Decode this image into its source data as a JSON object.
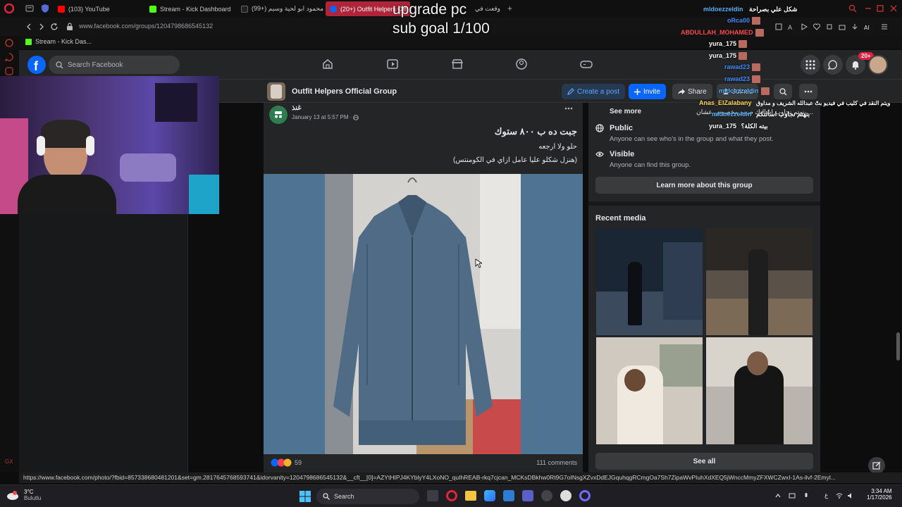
{
  "browser": {
    "tabs": [
      {
        "label": "(103) YouTube",
        "icon": "youtube-icon"
      },
      {
        "label": "Stream - Kick Dashboard",
        "icon": "kick-icon"
      },
      {
        "label": "(99+) محمود ابو لحية وسيم",
        "icon": "tiktok-icon"
      },
      {
        "label": "(20+) Outfit Helpers Off",
        "icon": "facebook-icon"
      },
      {
        "label": "وقعت في",
        "icon": "page-icon"
      }
    ],
    "new_tab": "+",
    "url": "www.facebook.com/groups/1204798686545132",
    "bookmark": "Stream - Kick Das..."
  },
  "stream_overlay": {
    "line1": "upgrade pc",
    "line2": "sub goal 1/100"
  },
  "chat": [
    {
      "user": "mldoezzeldin",
      "msg": "شكل علي بصراحة",
      "color": "#4fb3ff"
    },
    {
      "user": "oRca00",
      "msg": "",
      "color": "#3b8cff"
    },
    {
      "user": "ABDULLAH_MOHAMED",
      "msg": "",
      "color": "#ff4d4d"
    },
    {
      "user": "yura_175",
      "msg": "",
      "color": "#ffffff"
    },
    {
      "user": "yura_175",
      "msg": "",
      "color": "#ffffff"
    },
    {
      "user": "rawad23",
      "msg": "",
      "color": "#3b8cff"
    },
    {
      "user": "rawad23",
      "msg": "",
      "color": "#3b8cff"
    },
    {
      "user": "mldoezzeldin",
      "msg": "",
      "color": "#4fb3ff"
    },
    {
      "user": "Anas_ElZalabany",
      "msg": "ويتم النقد في كليب في فيديو بتّ عبدالله الشريف و مداوق",
      "color": "#ffd84a"
    },
    {
      "user": "mldoezzeldin",
      "msg": "بتهتم نجاوب اسألتكم",
      "color": "#4fb3ff"
    },
    {
      "user": "yura_175",
      "msg": "بيته الكلة؟",
      "color": "#ffffff"
    }
  ],
  "facebook": {
    "search_placeholder": "Search Facebook",
    "notification_count": "20+",
    "group_name": "Outfit Helpers Official Group",
    "create_post": "Create a post",
    "invite": "Invite",
    "share": "Share",
    "joined": "Joined",
    "post": {
      "author": "غنذ",
      "time": "January 13 at 5:57 PM · ",
      "title": "جبت ده ب ٨٠٠ ستوك",
      "line1": "حلو ولا ارجعه",
      "line2": "(هنزل شكلو عليا عامل ازاي في الكومنتس)",
      "reactions_count": "59",
      "comments": "111 comments"
    },
    "about": {
      "see_more": "See more",
      "see_more_text": "... بنهتم نجاوب اسالتك صمم مخصوص عشان",
      "public_title": "Public",
      "public_desc": "Anyone can see who's in the group and what they post.",
      "visible_title": "Visible",
      "visible_desc": "Anyone can find this group.",
      "learn_more": "Learn more about this group"
    },
    "recent_media_title": "Recent media",
    "see_all": "See all"
  },
  "status_url": "https://www.facebook.com/photo/?fbid=857338680481201&set=gm.2817645768593741&idorvanity=1204798686545132&__cft__[0]=AZYtHIPJ4KYblyY4LXoNO_quIhREAB-rkq7cjcan_MCKsDBkhw0Rt9G7oINsgXZvxDdEJGquhqgRCmgOa7Sh7ZipaWvPIuhXdXEQ5jWnccMmyZFXWCZwxI-1As-ilvf-2Emyl...",
  "taskbar": {
    "weather_temp": "3°C",
    "weather_desc": "Bulutlu",
    "search": "Search",
    "lang": "ع",
    "time": "3:34 AM",
    "date": "1/17/2026"
  },
  "colors": {
    "fb_blue": "#0866ff",
    "fb_card": "#242526",
    "opera_red": "#b0243a"
  }
}
